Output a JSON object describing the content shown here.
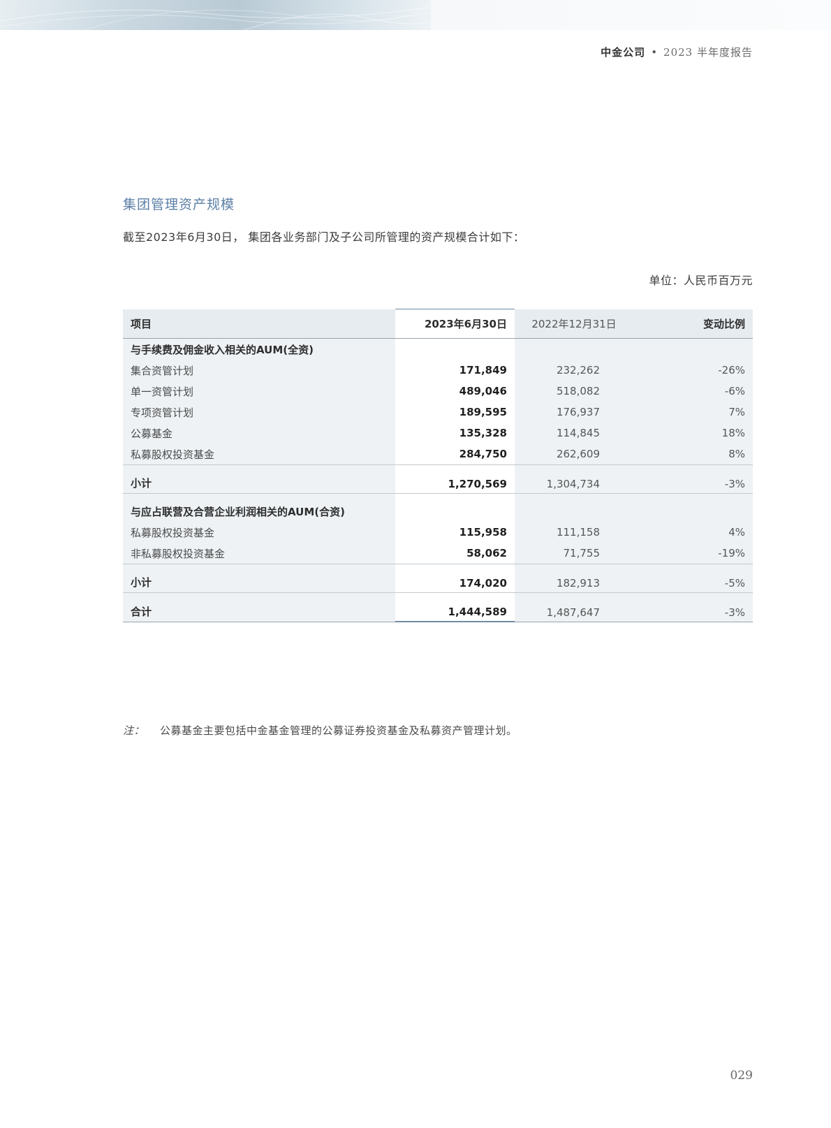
{
  "header": {
    "company": "中金公司",
    "separator": "•",
    "report": "2023 半年度报告"
  },
  "section": {
    "title": "集团管理资产规模",
    "intro": "截至2023年6月30日， 集团各业务部门及子公司所管理的资产规模合计如下：",
    "unit": "单位：人民币百万元"
  },
  "table": {
    "headers": {
      "item": "项目",
      "current": "2023年6月30日",
      "previous": "2022年12月31日",
      "change": "变动比例"
    },
    "group1": {
      "title": "与手续费及佣金收入相关的AUM(全资)",
      "rows": [
        {
          "label": "集合资管计划",
          "current": "171,849",
          "previous": "232,262",
          "change": "-26%"
        },
        {
          "label": "单一资管计划",
          "current": "489,046",
          "previous": "518,082",
          "change": "-6%"
        },
        {
          "label": "专项资管计划",
          "current": "189,595",
          "previous": "176,937",
          "change": "7%"
        },
        {
          "label": "公募基金",
          "current": "135,328",
          "previous": "114,845",
          "change": "18%"
        },
        {
          "label": "私募股权投资基金",
          "current": "284,750",
          "previous": "262,609",
          "change": "8%"
        }
      ],
      "subtotal": {
        "label": "小计",
        "current": "1,270,569",
        "previous": "1,304,734",
        "change": "-3%"
      }
    },
    "group2": {
      "title": "与应占联营及合营企业利润相关的AUM(合资)",
      "rows": [
        {
          "label": "私募股权投资基金",
          "current": "115,958",
          "previous": "111,158",
          "change": "4%"
        },
        {
          "label": "非私募股权投资基金",
          "current": "58,062",
          "previous": "71,755",
          "change": "-19%"
        }
      ],
      "subtotal": {
        "label": "小计",
        "current": "174,020",
        "previous": "182,913",
        "change": "-5%"
      }
    },
    "total": {
      "label": "合计",
      "current": "1,444,589",
      "previous": "1,487,647",
      "change": "-3%"
    }
  },
  "note": {
    "tag": "注：",
    "text": "公募基金主要包括中金基金管理的公募证券投资基金及私募资产管理计划。"
  },
  "page_number": "029"
}
